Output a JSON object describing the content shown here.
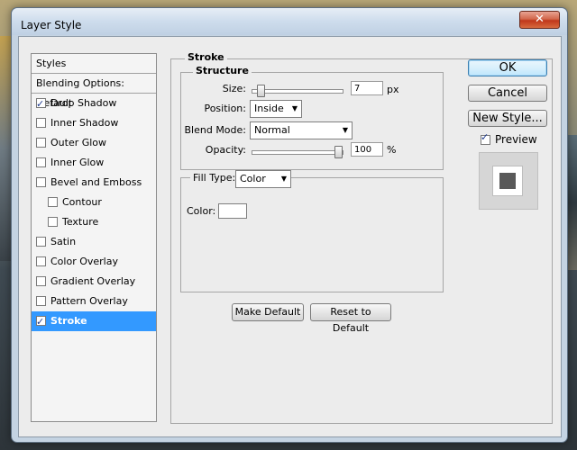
{
  "window": {
    "title": "Layer Style",
    "close_glyph": "✕"
  },
  "stylelist": {
    "header": "Styles",
    "blending": "Blending Options: Default",
    "items": [
      {
        "label": "Drop Shadow",
        "checked": true,
        "indent": false
      },
      {
        "label": "Inner Shadow",
        "checked": false,
        "indent": false
      },
      {
        "label": "Outer Glow",
        "checked": false,
        "indent": false
      },
      {
        "label": "Inner Glow",
        "checked": false,
        "indent": false
      },
      {
        "label": "Bevel and Emboss",
        "checked": false,
        "indent": false
      },
      {
        "label": "Contour",
        "checked": false,
        "indent": true
      },
      {
        "label": "Texture",
        "checked": false,
        "indent": true
      },
      {
        "label": "Satin",
        "checked": false,
        "indent": false
      },
      {
        "label": "Color Overlay",
        "checked": false,
        "indent": false
      },
      {
        "label": "Gradient Overlay",
        "checked": false,
        "indent": false
      },
      {
        "label": "Pattern Overlay",
        "checked": false,
        "indent": false
      },
      {
        "label": "Stroke",
        "checked": true,
        "indent": false,
        "selected": true
      }
    ]
  },
  "stroke": {
    "title": "Stroke",
    "structure": {
      "title": "Structure",
      "size_label": "Size:",
      "size_value": "7",
      "size_unit": "px",
      "size_slider": 0.05,
      "position_label": "Position:",
      "position_value": "Inside",
      "blend_label": "Blend Mode:",
      "blend_value": "Normal",
      "opacity_label": "Opacity:",
      "opacity_value": "100",
      "opacity_unit": "%",
      "opacity_slider": 1.0
    },
    "fill": {
      "type_label": "Fill Type:",
      "type_value": "Color",
      "color_label": "Color:",
      "color_value": "#ffffff"
    },
    "make_default": "Make Default",
    "reset_default": "Reset to Default"
  },
  "actions": {
    "ok": "OK",
    "cancel": "Cancel",
    "new_style": "New Style...",
    "preview_label": "Preview",
    "preview_checked": true
  },
  "colors": {
    "selection": "#3399ff",
    "preview_square": "#595959"
  }
}
